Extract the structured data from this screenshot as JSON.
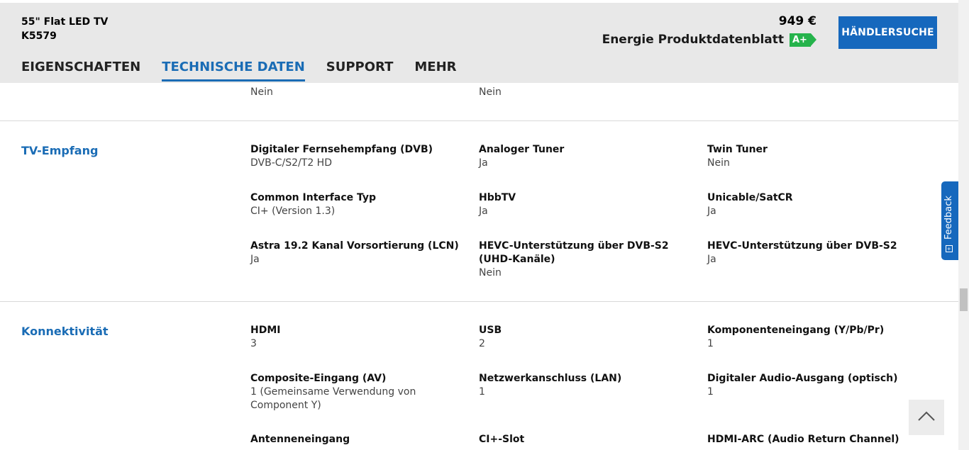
{
  "header": {
    "model_name": "55\" Flat LED TV",
    "model_code": "K5579",
    "price": "949 €",
    "energy_label": "Energie Produktdatenblatt",
    "energy_class": "A+",
    "dealer_button": "HÄNDLERSUCHE",
    "tabs": [
      {
        "label": "EIGENSCHAFTEN",
        "active": false
      },
      {
        "label": "TECHNISCHE DATEN",
        "active": true
      },
      {
        "label": "SUPPORT",
        "active": false
      },
      {
        "label": "MEHR",
        "active": false
      }
    ]
  },
  "previous_row": [
    "Nein",
    "Nein"
  ],
  "sections": [
    {
      "title": "TV-Empfang",
      "specs": [
        {
          "label": "Digitaler Fernsehempfang (DVB)",
          "value": "DVB-C/S2/T2 HD"
        },
        {
          "label": "Analoger Tuner",
          "value": "Ja"
        },
        {
          "label": "Twin Tuner",
          "value": "Nein"
        },
        {
          "label": "Common Interface Typ",
          "value": "CI+ (Version 1.3)"
        },
        {
          "label": "HbbTV",
          "value": "Ja"
        },
        {
          "label": "Unicable/SatCR",
          "value": "Ja"
        },
        {
          "label": "Astra 19.2 Kanal Vorsortierung (LCN)",
          "value": "Ja"
        },
        {
          "label": "HEVC-Unterstützung über DVB-S2 (UHD-Kanäle)",
          "value": "Nein"
        },
        {
          "label": "HEVC-Unterstützung über DVB-S2",
          "value": "Ja"
        }
      ]
    },
    {
      "title": "Konnektivität",
      "specs": [
        {
          "label": "HDMI",
          "value": "3"
        },
        {
          "label": "USB",
          "value": "2"
        },
        {
          "label": "Komponenteneingang (Y/Pb/Pr)",
          "value": "1"
        },
        {
          "label": "Composite-Eingang (AV)",
          "value": "1 (Gemeinsame Verwendung von Component Y)"
        },
        {
          "label": "Netzwerkanschluss (LAN)",
          "value": "1"
        },
        {
          "label": "Digitaler Audio-Ausgang (optisch)",
          "value": "1"
        },
        {
          "label": "Antenneneingang",
          "value": ""
        },
        {
          "label": "CI+-Slot",
          "value": ""
        },
        {
          "label": "HDMI-ARC (Audio Return Channel)",
          "value": ""
        }
      ]
    }
  ],
  "feedback_label": "Feedback"
}
